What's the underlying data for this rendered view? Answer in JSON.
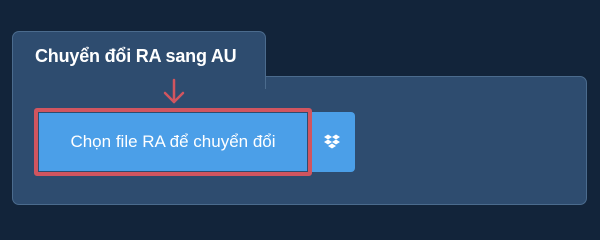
{
  "tab": {
    "title": "Chuyển đổi RA sang AU"
  },
  "actions": {
    "choose_file_label": "Chọn file RA để chuyển đổi",
    "dropbox_icon": "dropbox-icon"
  },
  "colors": {
    "background": "#12243a",
    "panel": "#2e4c6f",
    "panel_border": "#4b6b8d",
    "button": "#4b9fe8",
    "highlight": "#d1555f"
  }
}
